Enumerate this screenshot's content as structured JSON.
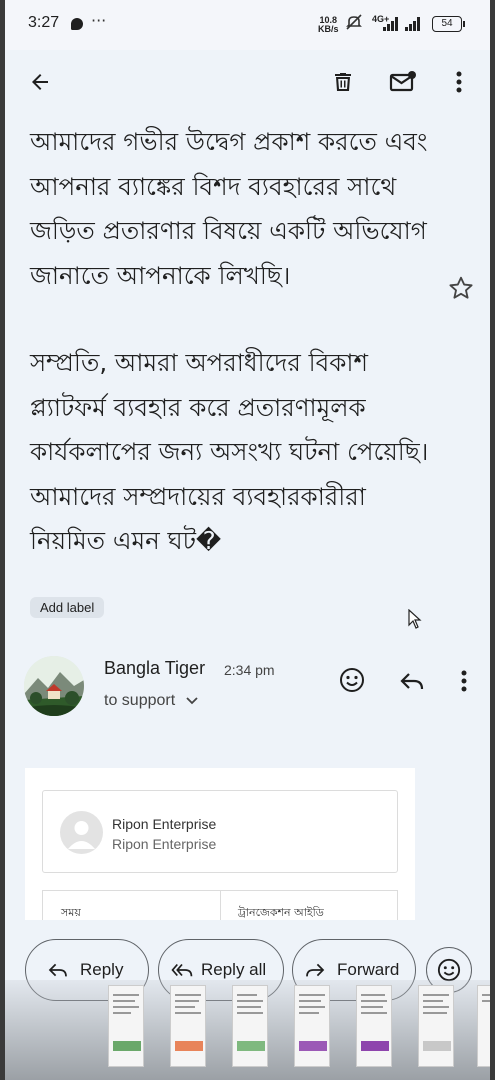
{
  "status_bar": {
    "time": "3:27",
    "speed_value": "10.8",
    "speed_unit": "KB/s",
    "network": "4G+",
    "battery": "54"
  },
  "email": {
    "body_paragraph_1": "আমাদের গভীর উদ্বেগ প্রকাশ করতে এবং আপনার ব্যাঙ্কের বিশদ ব্যবহারের সাথে জড়িত প্রতারণার বিষয়ে একটি অভিযোগ জানাতে আপনাকে লিখছি।",
    "body_paragraph_2": "সম্প্রতি, আমরা অপরাধীদের বিকাশ প্ল্যাটফর্ম ব্যবহার করে প্রতারণামূলক কার্যকলাপের জন্য অসংখ্য ঘটনা পেয়েছি। আমাদের সম্প্রদায়ের ব্যবহারকারীরা নিয়মিত এমন ঘট�",
    "add_label": "Add label"
  },
  "message": {
    "sender_name": "Bangla Tiger",
    "time": "2:34 pm",
    "recipient": "to support"
  },
  "receipt": {
    "merchant_name": "Ripon Enterprise",
    "merchant_subtitle": "Ripon Enterprise",
    "col_time": "সময়",
    "col_transaction_id": "ট্রানজেকশন আইডি"
  },
  "actions": {
    "reply": "Reply",
    "reply_all": "Reply all",
    "forward": "Forward"
  },
  "colors": {
    "background": "#eef3f9",
    "text": "#1f1f1f",
    "chip": "#dde3ea"
  },
  "icons": [
    "back-arrow-icon",
    "delete-icon",
    "mark-unread-icon",
    "more-vert-icon",
    "star-icon",
    "emoji-icon",
    "reply-icon",
    "reply-all-icon",
    "forward-icon",
    "chevron-down-icon"
  ]
}
